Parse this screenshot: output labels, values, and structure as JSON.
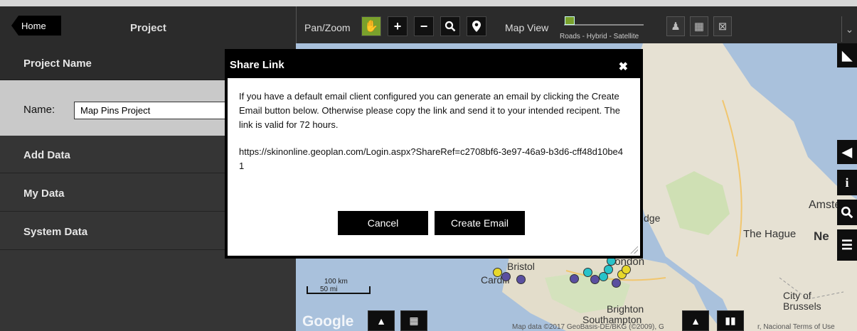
{
  "toolbar": {
    "home_label": "Home",
    "project_title": "Project",
    "pan_zoom_label": "Pan/Zoom",
    "map_view_label": "Map View",
    "map_view_options": "Roads - Hybrid - Satellite",
    "accent_color": "#7aa12c"
  },
  "sidebar": {
    "project_name_header": "Project Name",
    "name_label": "Name:",
    "name_value": "Map Pins Project",
    "items": [
      {
        "label": "Add Data"
      },
      {
        "label": "My Data"
      },
      {
        "label": "System Data"
      }
    ]
  },
  "map": {
    "labels": {
      "bridge_fragment": "dge",
      "amsterdam": "Amster",
      "hague": "The Hague",
      "ne": "Ne",
      "bristol": "Bristol",
      "cardiff": "Cardiff",
      "london": "London",
      "brighton": "Brighton",
      "southampton": "Southampton",
      "city_of_brussels": "City of\nBrussels"
    },
    "scale_km": "100 km",
    "scale_mi": "50 mi",
    "google": "Google",
    "attribution": "Map data ©2017 GeoBasis-DE/BKG (©2009), G",
    "attribution_right": "r, Nacional   Terms of Use",
    "pin_colors": [
      "#e8d82a",
      "#5a4fa0",
      "#29c3c9"
    ]
  },
  "modal": {
    "title": "Share Link",
    "close": "✖",
    "message": "If you have a default email client configured you can generate an email by clicking the Create Email button below. Otherwise please copy the link and send it to your intended recipent. The link is valid for 72 hours.",
    "link": "https://skinonline.geoplan.com/Login.aspx?ShareRef=c2708bf6-3e97-46a9-b3d6-cff48d10be41",
    "cancel_label": "Cancel",
    "create_email_label": "Create Email"
  }
}
